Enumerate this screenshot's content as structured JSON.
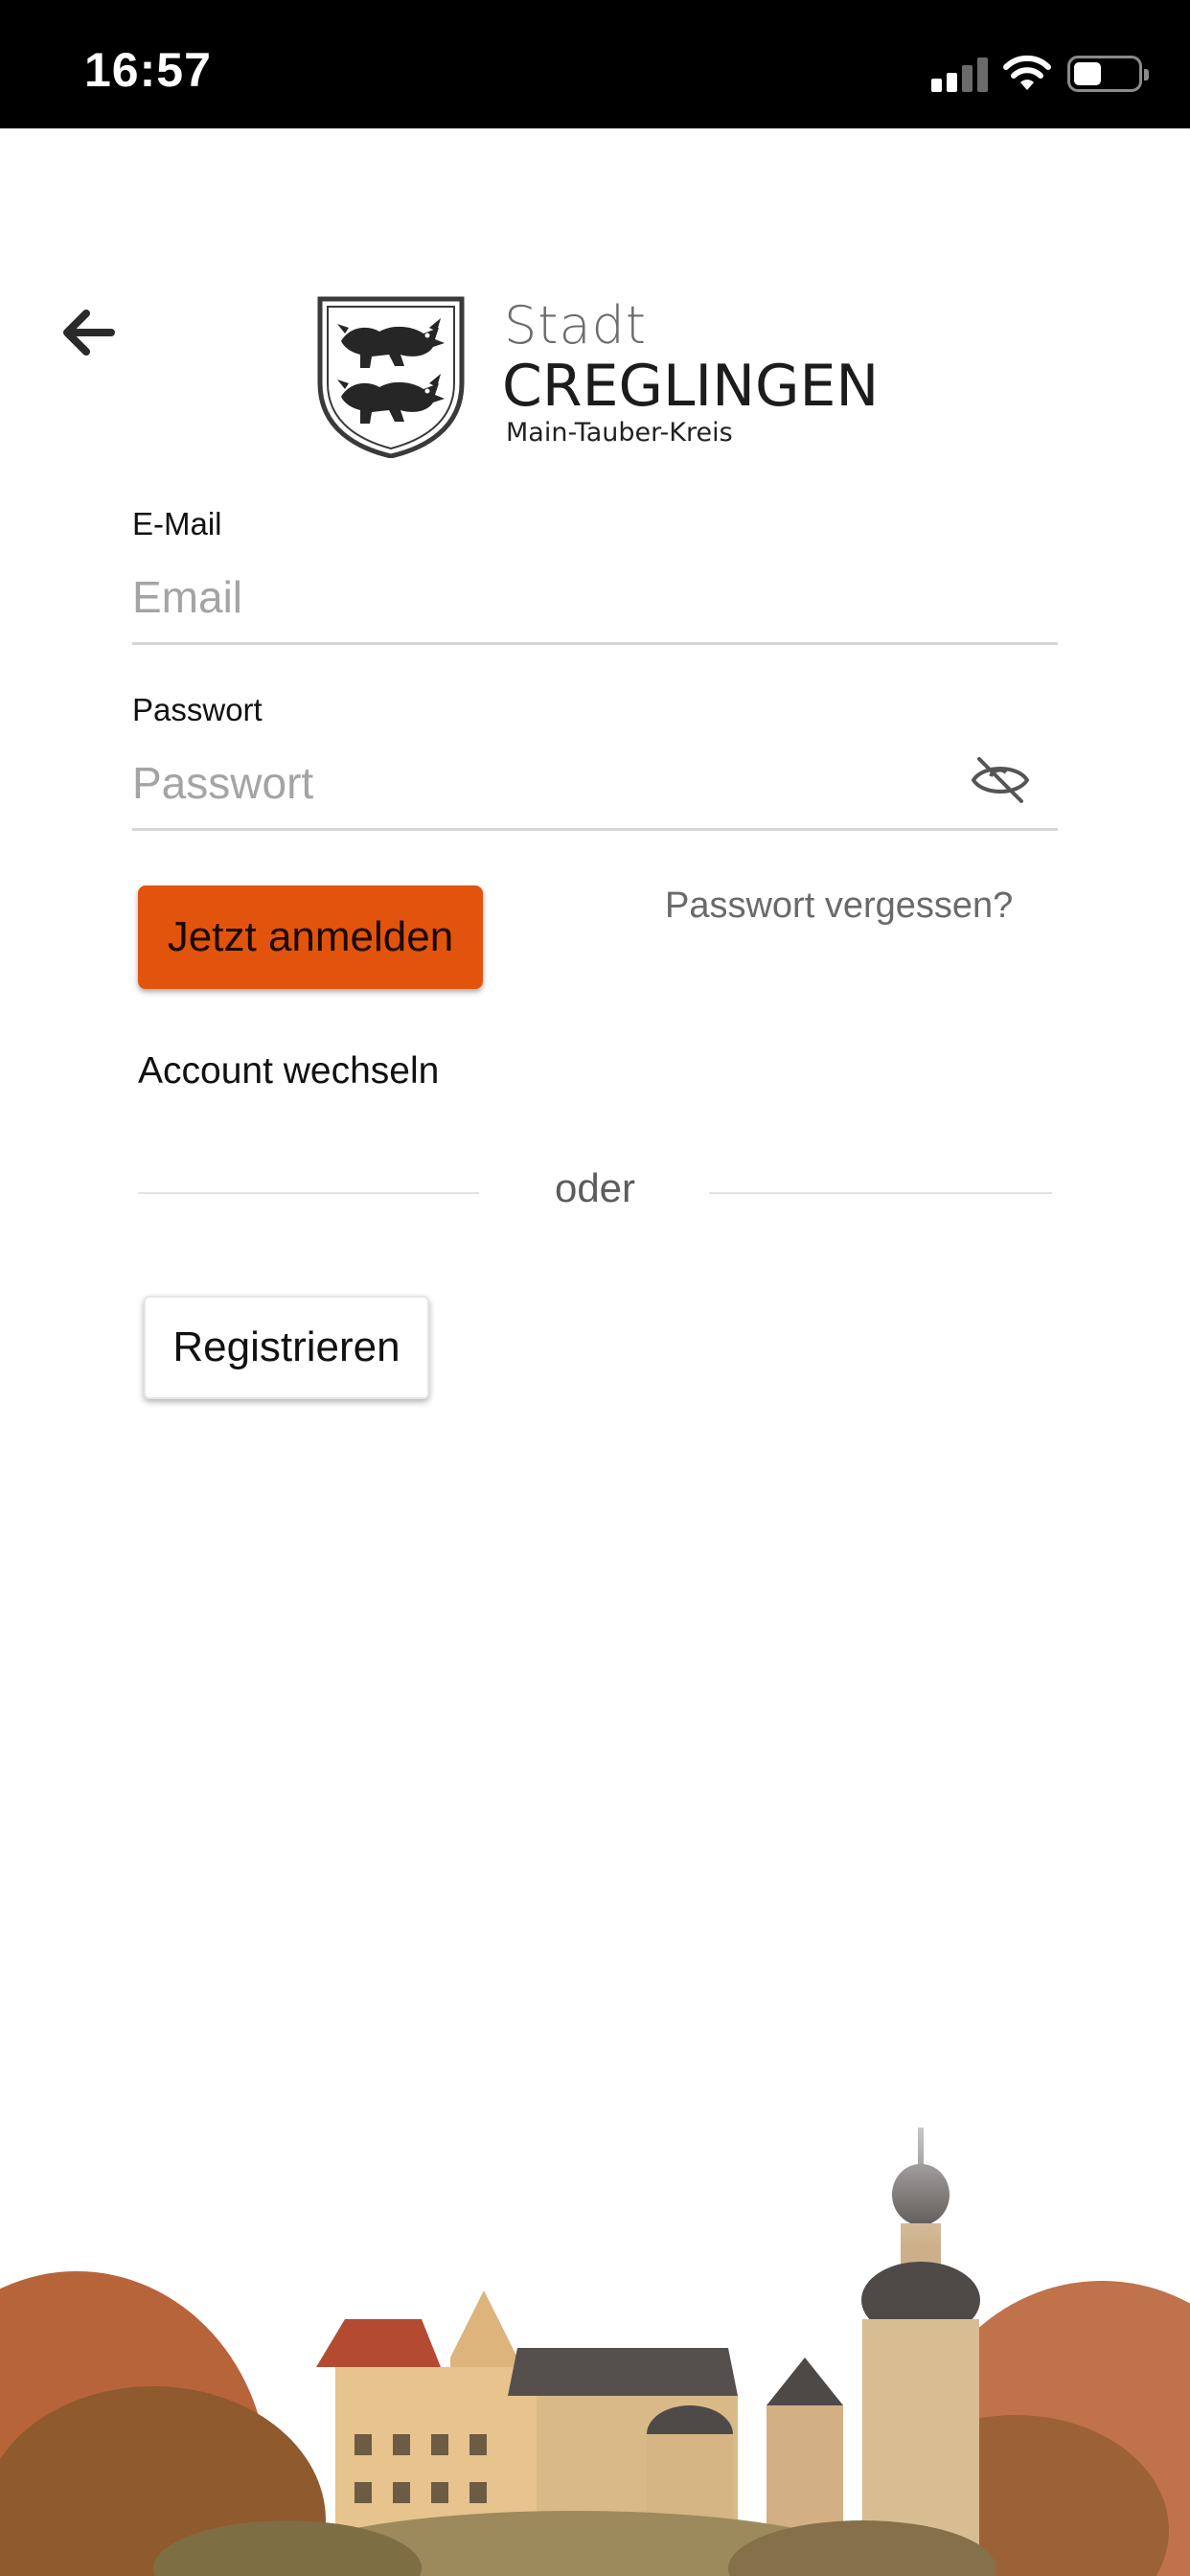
{
  "status_bar": {
    "time": "16:57",
    "icons": [
      "cellular-signal-icon",
      "wifi-icon",
      "battery-icon"
    ]
  },
  "header": {
    "back_icon": "arrow-left-icon",
    "logo": {
      "line1": "Stadt",
      "line2": "CREGLINGEN",
      "line3": "Main-Tauber-Kreis"
    }
  },
  "form": {
    "email": {
      "label": "E-Mail",
      "placeholder": "Email",
      "value": ""
    },
    "password": {
      "label": "Passwort",
      "placeholder": "Passwort",
      "value": "",
      "toggle_icon": "eye-slash-icon"
    },
    "login_label": "Jetzt anmelden",
    "forgot_label": "Passwort vergessen?",
    "switch_account_label": "Account wechseln",
    "divider_label": "oder",
    "register_label": "Registrieren"
  },
  "colors": {
    "accent": "#e2540d",
    "status_bar_bg": "#000000",
    "placeholder": "#a4a4a4",
    "secondary_text": "#6a6a6a"
  }
}
